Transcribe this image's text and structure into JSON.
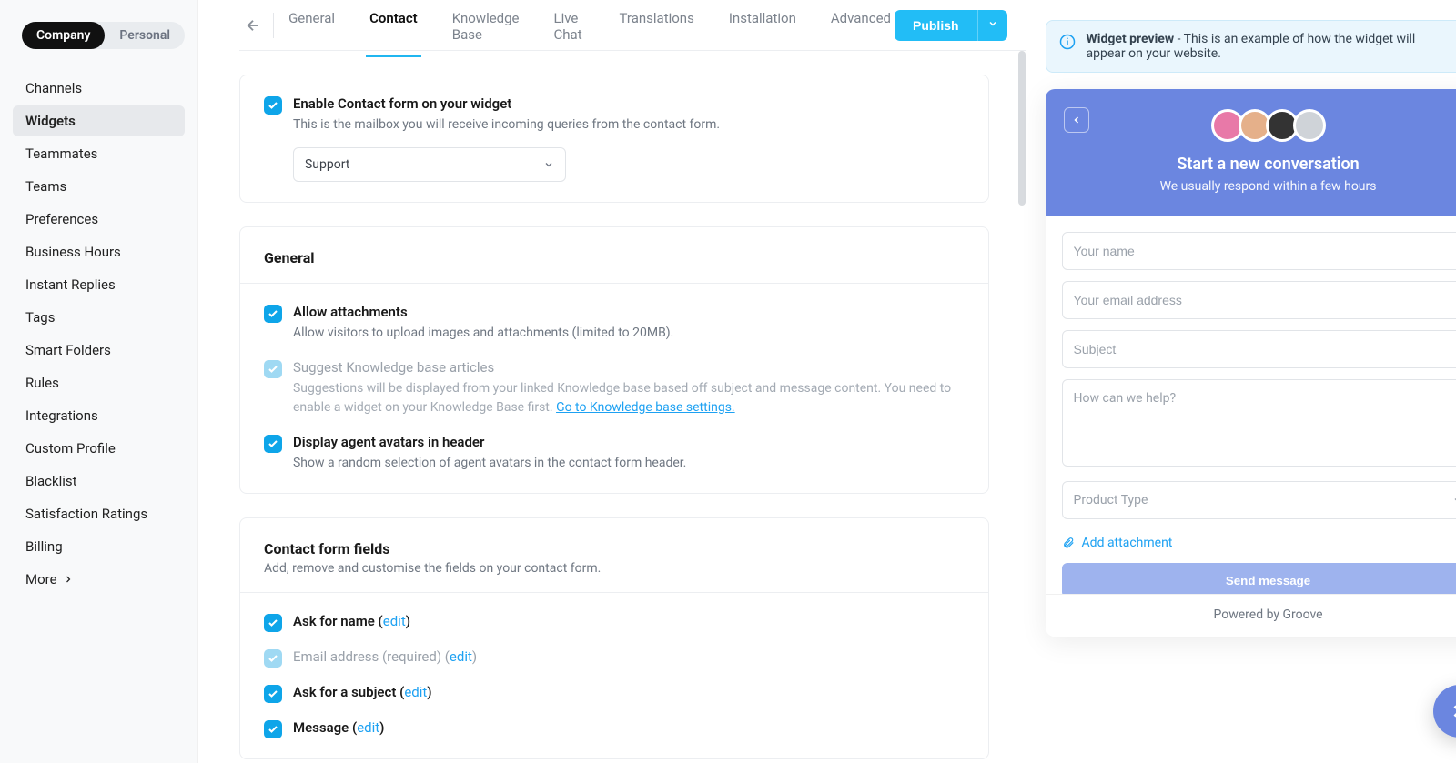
{
  "scope": {
    "company": "Company",
    "personal": "Personal"
  },
  "sidebar": {
    "items": [
      "Channels",
      "Widgets",
      "Teammates",
      "Teams",
      "Preferences",
      "Business Hours",
      "Instant Replies",
      "Tags",
      "Smart Folders",
      "Rules",
      "Integrations",
      "Custom Profile",
      "Blacklist",
      "Satisfaction Ratings",
      "Billing"
    ],
    "more": "More"
  },
  "tabs": [
    "General",
    "Contact",
    "Knowledge Base",
    "Live Chat",
    "Translations",
    "Installation",
    "Advanced"
  ],
  "active_tab": "Contact",
  "publish": {
    "label": "Publish"
  },
  "enable_card": {
    "title": "Enable Contact form on your widget",
    "desc": "This is the mailbox you will receive incoming queries from the contact form.",
    "select_value": "Support"
  },
  "general_card": {
    "heading": "General",
    "items": [
      {
        "title": "Allow attachments",
        "desc": "Allow visitors to upload images and attachments (limited to 20MB).",
        "muted": false
      },
      {
        "title": "Suggest Knowledge base articles",
        "desc": "Suggestions will be displayed from your linked Knowledge base based off subject and message content. You need to enable a widget on your Knowledge Base first. ",
        "link": "Go to Knowledge base settings.",
        "muted": true
      },
      {
        "title": "Display agent avatars in header",
        "desc": "Show a random selection of agent avatars in the contact form header.",
        "muted": false
      }
    ]
  },
  "fields_card": {
    "heading": "Contact form fields",
    "sub": "Add, remove and customise the fields on your contact form.",
    "items": [
      {
        "label_pre": "Ask for name (",
        "edit": "edit",
        "label_post": ")",
        "muted": false
      },
      {
        "label_pre": "Email address (required) (",
        "edit": "edit",
        "label_post": ")",
        "muted": true
      },
      {
        "label_pre": "Ask for a subject (",
        "edit": "edit",
        "label_post": ")",
        "muted": false
      },
      {
        "label_pre": "Message (",
        "edit": "edit",
        "label_post": ")",
        "muted": false
      }
    ]
  },
  "notice": {
    "bold": "Widget preview",
    "text": " - This is an example of how the widget will appear on your website."
  },
  "preview": {
    "title": "Start a new conversation",
    "sub": "We usually respond within a few hours",
    "ph_name": "Your name",
    "ph_email": "Your email address",
    "ph_subject": "Subject",
    "ph_msg": "How can we help?",
    "select": "Product Type",
    "attach": "Add attachment",
    "send": "Send message",
    "foot": "Powered by Groove",
    "avatars": [
      "#e879a8",
      "#e5b08a",
      "#333333",
      "#cfd3d8"
    ]
  }
}
